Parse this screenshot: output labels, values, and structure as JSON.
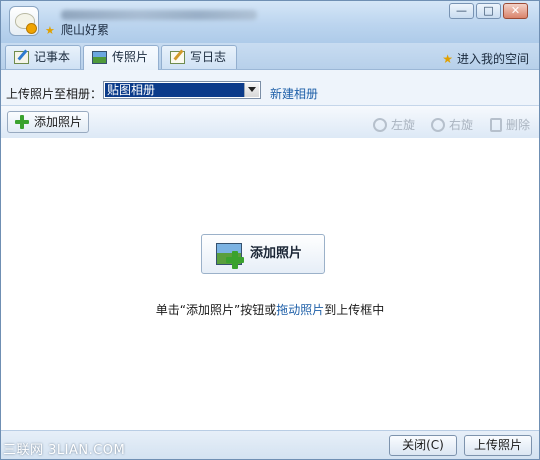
{
  "window": {
    "title_name": "爬山好累",
    "controls": {
      "minimize": "—",
      "maximize": "□",
      "close": "✕"
    }
  },
  "tabs": [
    {
      "label": "记事本",
      "icon": "notepad-icon"
    },
    {
      "label": "传照片",
      "icon": "photo-icon",
      "active": true
    },
    {
      "label": "写日志",
      "icon": "diary-icon"
    }
  ],
  "space_link": {
    "label": "进入我的空间",
    "icon": "star-icon"
  },
  "album": {
    "label": "上传照片至相册：",
    "selected": "贴图相册",
    "new_album": "新建相册"
  },
  "toolbar": {
    "add_label": "添加照片",
    "rotate_left": "左旋",
    "rotate_right": "右旋",
    "delete": "删除"
  },
  "main": {
    "big_add_label": "添加照片",
    "hint_before": "单击“添加照片”按钮或",
    "hint_link": "拖动照片",
    "hint_after": "到上传框中"
  },
  "footer": {
    "watermark": "三联网 3LIAN.COM",
    "close_label": "关闭(C)",
    "upload_label": "上传照片"
  },
  "colors": {
    "link": "#1e5fa8",
    "selection": "#0b3b8a",
    "accent_green": "#3aa22e"
  }
}
